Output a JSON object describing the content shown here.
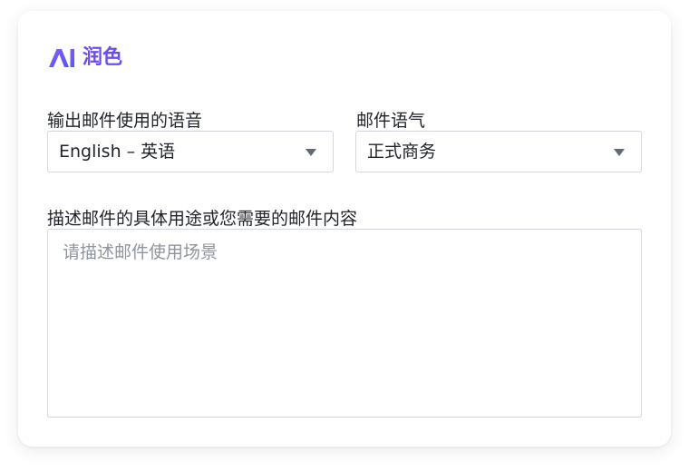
{
  "panel": {
    "title": "润色",
    "logo_text": "AI",
    "logo_icon": "ai-logo-icon",
    "accent_color": "#6c4df0"
  },
  "language": {
    "label": "输出邮件使用的语音",
    "selected": "English – 英语",
    "icon": "caret-down-icon"
  },
  "tone": {
    "label": "邮件语气",
    "selected": "正式商务",
    "icon": "caret-down-icon"
  },
  "description": {
    "label": "描述邮件的具体用途或您需要的邮件内容",
    "value": "",
    "placeholder": "请描述邮件使用场景"
  }
}
